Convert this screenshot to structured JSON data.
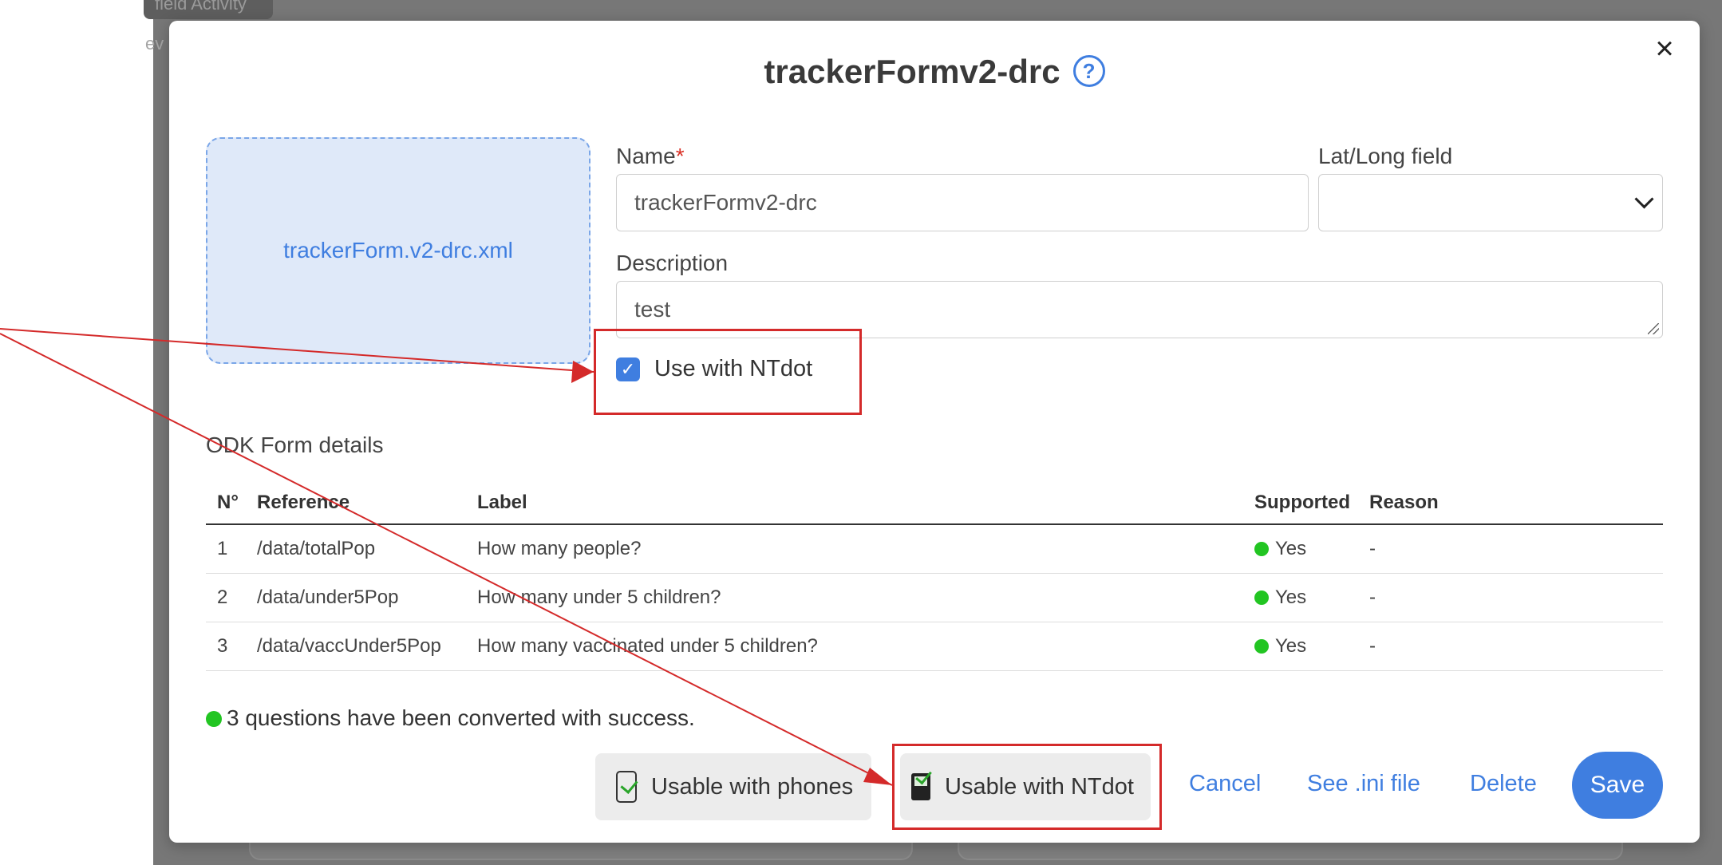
{
  "background": {
    "tab_label": "field Activity",
    "fragment": "ev"
  },
  "modal": {
    "title": "trackerFormv2-drc",
    "help_icon": "?",
    "close_icon": "×",
    "file_name": "trackerForm.v2-drc.xml",
    "name_label": "Name",
    "name_required_mark": "*",
    "name_value": "trackerFormv2-drc",
    "latlong_label": "Lat/Long field",
    "latlong_value": "",
    "description_label": "Description",
    "description_value": "test",
    "use_ntdot_label": "Use with NTdot",
    "use_ntdot_checked": true
  },
  "odk": {
    "section_title": "ODK Form details",
    "columns": [
      "N°",
      "Reference",
      "Label",
      "Supported",
      "Reason"
    ],
    "rows": [
      {
        "n": "1",
        "reference": "/data/totalPop",
        "label": "How many people?",
        "supported": "Yes",
        "reason": "-"
      },
      {
        "n": "2",
        "reference": "/data/under5Pop",
        "label": "How many under 5 children?",
        "supported": "Yes",
        "reason": "-"
      },
      {
        "n": "3",
        "reference": "/data/vaccUnder5Pop",
        "label": "How many vaccinated under 5 children?",
        "supported": "Yes",
        "reason": "-"
      }
    ],
    "success_message": "3 questions have been converted with success."
  },
  "footer": {
    "phones_label": "Usable with phones",
    "ntdot_label": "Usable with NTdot",
    "cancel_label": "Cancel",
    "ini_label": "See .ini file",
    "delete_label": "Delete",
    "save_label": "Save"
  },
  "colors": {
    "accent": "#3f7ee0",
    "success": "#22c522",
    "annotation": "#d42a2a"
  }
}
